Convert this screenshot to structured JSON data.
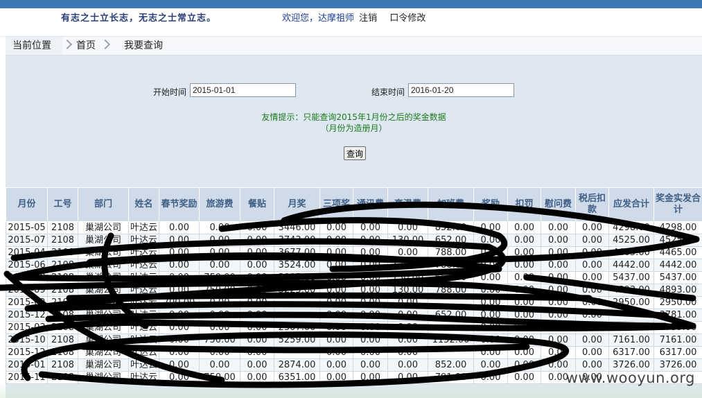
{
  "header": {
    "slogan": "有志之士立长志，无志之士常立志。",
    "welcome": "欢迎您，达摩祖师",
    "logout": "注销",
    "change_password": "口令修改"
  },
  "breadcrumb": {
    "label": "当前位置",
    "items": [
      "首页",
      "我要查询"
    ]
  },
  "form": {
    "start_label": "开始时间",
    "start_value": "2015-01-01",
    "end_label": "结束时间",
    "end_value": "2016-01-20",
    "tip_line1": "友情提示：只能查询2015年1月份之后的奖金数据",
    "tip_line2": "（月份为造册月）",
    "query_button": "查询"
  },
  "table": {
    "headers": [
      "月份",
      "工号",
      "部门",
      "姓名",
      "春节奖励",
      "旅游费",
      "餐贴",
      "月奖",
      "三项奖",
      "通讯费",
      "高温费",
      "加班费",
      "奖励",
      "扣罚",
      "慰问费",
      "税后扣款",
      "应发合计",
      "奖金实发合计"
    ],
    "rows": [
      [
        "2015-05",
        "2108",
        "巢湖公司",
        "叶达云",
        "0.00",
        "0.00",
        "0.00",
        "3446.00",
        "0.00",
        "0.00",
        "0.00",
        "852.00",
        "0.00",
        "0.00",
        "0.00",
        "0.00",
        "4298.00",
        "4298.00"
      ],
      [
        "2015-07",
        "2108",
        "巢湖公司",
        "叶达云",
        "0.00",
        "0.00",
        "0.00",
        "3743.00",
        "0.00",
        "0.00",
        "130.00",
        "652.00",
        "0.00",
        "0.00",
        "0.00",
        "0.00",
        "4525.00",
        "4525.00"
      ],
      [
        "2015-04",
        "2108",
        "巢湖公司",
        "叶达云",
        "0.00",
        "0.00",
        "0.00",
        "3677.00",
        "0.00",
        "0.00",
        "0.00",
        "788.00",
        "0.00",
        "0.00",
        "0.00",
        "0.00",
        "4465.00",
        "4465.00"
      ],
      [
        "2015-06",
        "2108",
        "巢湖公司",
        "叶达云",
        "0.00",
        "0.00",
        "0.00",
        "3524.00",
        "0.00",
        "0.00",
        "130.00",
        "788.00",
        "0.00",
        "0.00",
        "0.00",
        "0.00",
        "4442.00",
        "4442.00"
      ],
      [
        "2015-08",
        "2108",
        "巢湖公司",
        "叶达云",
        "0.00",
        "750.00",
        "0.00",
        "3905.00",
        "0.00",
        "0.00",
        "130.00",
        "652.00",
        "0.00",
        "0.00",
        "0.00",
        "0.00",
        "5437.00",
        "5437.00"
      ],
      [
        "2015-09",
        "2108",
        "巢湖公司",
        "叶达云",
        "0.00",
        "750.00",
        "0.00",
        "3225.00",
        "0.00",
        "0.00",
        "130.00",
        "788.00",
        "0.00",
        "0.00",
        "0.00",
        "0.00",
        "4893.00",
        "4893.00"
      ],
      [
        "2015-02",
        "2108",
        "巢湖公司",
        "叶达云",
        "700.00",
        "0.00",
        "0.00",
        "",
        "0.00",
        "0.00",
        "0.00",
        "",
        "0.00",
        "0.00",
        "0.00",
        "0.00",
        "2950.00",
        "2950.00"
      ],
      [
        "2015-12",
        "2108",
        "巢湖公司",
        "叶达云",
        "0.00",
        "0.00",
        "0.00",
        "",
        "0.00",
        "0.00",
        "0.00",
        "652.00",
        "0.00",
        "0.00",
        "0.00",
        "0.00",
        "",
        "3781.00"
      ],
      [
        "2015-03",
        "2108",
        "巢湖公司",
        "叶达云",
        "0.00",
        "0.00",
        "0.00",
        "2307.00",
        "0.00",
        "0.00",
        "0.00",
        "",
        "0.00",
        "0.00",
        "0.00",
        "0.00",
        "2959.00",
        "2959.00"
      ],
      [
        "2015-10",
        "2108",
        "巢湖公司",
        "叶达云",
        "0.00",
        "750.00",
        "0.00",
        "5259.00",
        "0.00",
        "0.00",
        "0.00",
        "1152.00",
        "0.00",
        "0.00",
        "0.00",
        "0.00",
        "7161.00",
        "7161.00"
      ],
      [
        "2015-12",
        "2108",
        "巢湖公司",
        "叶达云",
        "0.00",
        "0.00",
        "0.00",
        "",
        "0.00",
        "0.00",
        "0.00",
        "",
        "0.00",
        "0.00",
        "0.00",
        "0.00",
        "6317.00",
        "6317.00"
      ],
      [
        "2015-01",
        "2108",
        "巢湖公司",
        "叶达云",
        "0.00",
        "0.00",
        "0.00",
        "2874.00",
        "0.00",
        "0.00",
        "0.00",
        "852.00",
        "0.00",
        "0.00",
        "0.00",
        "0.00",
        "3726.00",
        "3726.00"
      ],
      [
        "2015-11",
        "2108",
        "巢湖公司",
        "叶达云",
        "0.00",
        "750.00",
        "0.00",
        "6351.00",
        "0.00",
        "0.00",
        "0.00",
        "791.00",
        "0.00",
        "0.00",
        "0.00",
        "0.00",
        "",
        ""
      ]
    ]
  },
  "watermark": "www.wooyun.org",
  "colors": {
    "topbar": "#3a77b5",
    "panel_bg": "#dfe8f2",
    "header_bg": "#cfdbe8",
    "header_text": "#3f5f86",
    "tip_green": "#1a7a1a",
    "scribble": "#000000"
  }
}
